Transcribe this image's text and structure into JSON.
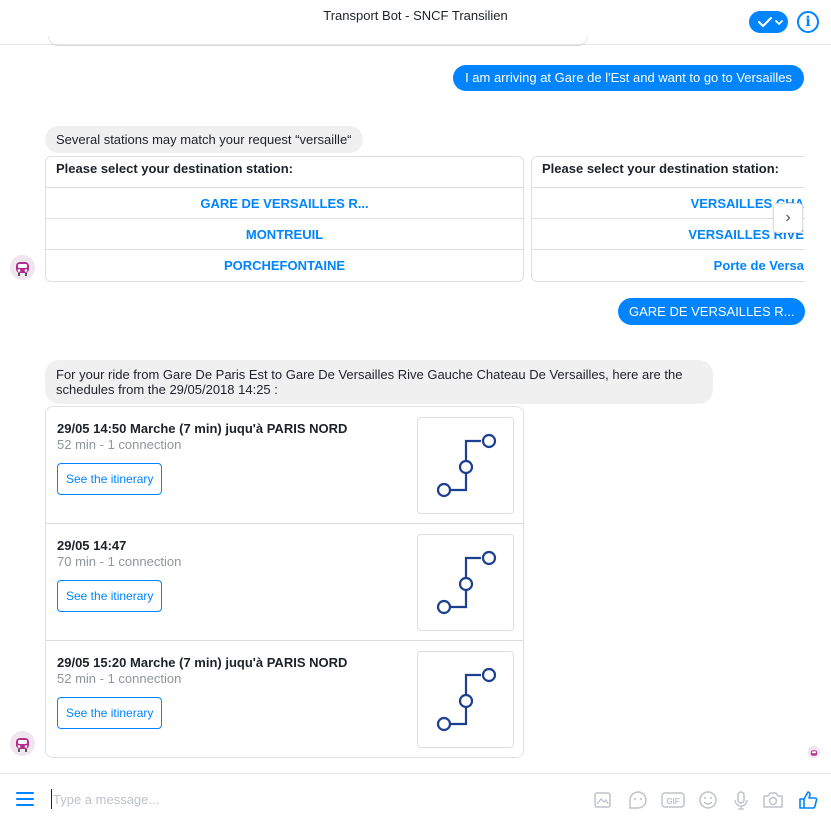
{
  "header": {
    "title": "Transport Bot - SNCF Transilien",
    "check_icon": "check-dropdown-icon",
    "info_icon": "info-icon",
    "accent_color": "#0084ff"
  },
  "messages": {
    "user_message": "I am arriving at Gare de l'Est and want to go to Versailles",
    "bot_disambiguation": "Several stations may match your request “versaille“",
    "station_cards": [
      {
        "heading": "Please select your destination station:",
        "options": [
          "GARE DE VERSAILLES R...",
          "MONTREUIL",
          "PORCHEFONTAINE"
        ]
      },
      {
        "heading": "Please select your destination station:",
        "options": [
          "VERSAILLES CHA",
          "VERSAILLES RIVE",
          "Porte de Versa"
        ]
      }
    ],
    "selected_reply": "GARE DE VERSAILLES R...",
    "bot_schedule_intro": "For your ride from Gare De Paris Est to Gare De Versailles Rive Gauche Chateau De Versailles, here are the schedules from the 29/05/2018 14:25 :",
    "schedules": [
      {
        "title": "29/05 14:50 Marche (7 min) juqu'à PARIS NORD",
        "subtitle": "52 min - 1 connection",
        "button": "See the itinerary"
      },
      {
        "title": "29/05 14:47",
        "subtitle": "70 min - 1 connection",
        "button": "See the itinerary"
      },
      {
        "title": "29/05 15:20 Marche (7 min) juqu'à PARIS NORD",
        "subtitle": "52 min - 1 connection",
        "button": "See the itinerary"
      }
    ]
  },
  "composer": {
    "placeholder": "Type a message...",
    "icons": [
      "menu-icon",
      "image-icon",
      "sticker-icon",
      "gif-icon",
      "emoji-icon",
      "microphone-icon",
      "camera-icon",
      "thumbs-up-icon"
    ]
  }
}
